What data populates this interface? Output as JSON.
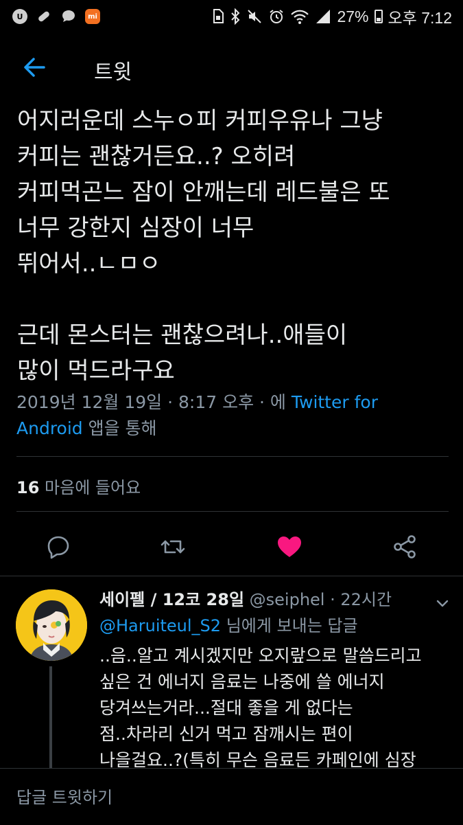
{
  "status_bar": {
    "battery_text": "27%",
    "time": "오후 7:12",
    "mi_label": "mi",
    "app_icons": [
      "u-plus-icon",
      "pill-icon",
      "chat-bubble-icon",
      "mi-icon"
    ],
    "system_icons": [
      "storage-icon",
      "bluetooth-icon",
      "mute-icon",
      "alarm-icon",
      "wifi-icon",
      "signal-icon",
      "battery-icon"
    ]
  },
  "header": {
    "title": "트윗"
  },
  "tweet": {
    "body": "어지러운데 스누ㅇ피 커피우유나 그냥\n커피는 괜찮거든요..? 오히려\n커피먹곤느 잠이 안깨는데 레드불은 또\n너무 강한지 심장이 너무\n뛰어서..ㄴㅁㅇ\n\n근데 몬스터는 괜찮으려나..애들이\n많이 먹드라구요",
    "meta_date": "2019년 12월 19일 · 8:17 오후 · 에 ",
    "meta_source_line1": "Twitter for",
    "meta_source_line2": "Android",
    "meta_suffix": " 앱을 통해",
    "likes_count": "16",
    "likes_label": " 마음에 들어요",
    "liked": true,
    "like_color": "#f91880"
  },
  "reply": {
    "name": "세이펠 / 12코 28일",
    "handle": " @seiphel · 22시간",
    "reply_to_user": "@Haruiteul_S2",
    "reply_to_suffix": " 님에게 보내는 답글",
    "text": "..음..알고 계시겠지만 오지랖으로 말씀드리고\n싶은 건 에너지 음료는 나중에 쓸 에너지\n당겨쓰는거라...절대 좋을 게 없다는\n점..차라리 신거 먹고 잠깨시는 편이\n나을걸요..?(특히 무슨 음료든 카페인에 심장"
  },
  "compose": {
    "placeholder": "답글 트윗하기"
  },
  "colors": {
    "background": "#000000",
    "accent": "#1d9bf0",
    "secondary_text": "#8b98a5"
  }
}
